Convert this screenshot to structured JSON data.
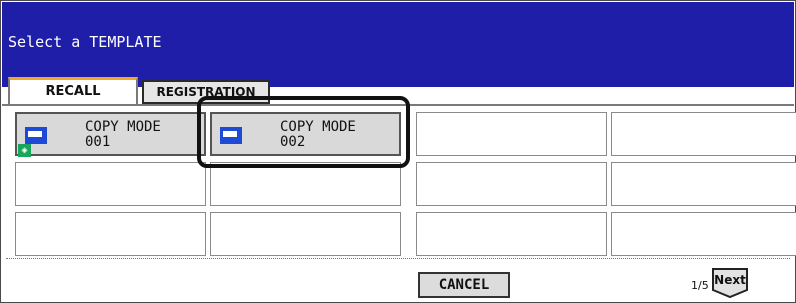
{
  "header": {
    "title": "Select a TEMPLATE"
  },
  "tabs": [
    {
      "label": "RECALL",
      "active": true
    },
    {
      "label": "REGISTRATION",
      "active": false
    }
  ],
  "templates": [
    {
      "line1": "COPY MODE",
      "line2": "001",
      "icon": "copy-template-icon",
      "badge": "shared-template-icon"
    },
    {
      "line1": "COPY MODE",
      "line2": "002",
      "icon": "copy-template-icon"
    }
  ],
  "footer": {
    "cancel_label": "CANCEL",
    "page_indicator": "1/5",
    "next_label": "Next"
  },
  "colors": {
    "header_bg": "#1e1ea8",
    "tab_accent": "#f2a623",
    "icon_blue": "#1e4ad6",
    "badge_green": "#1aa65a"
  }
}
